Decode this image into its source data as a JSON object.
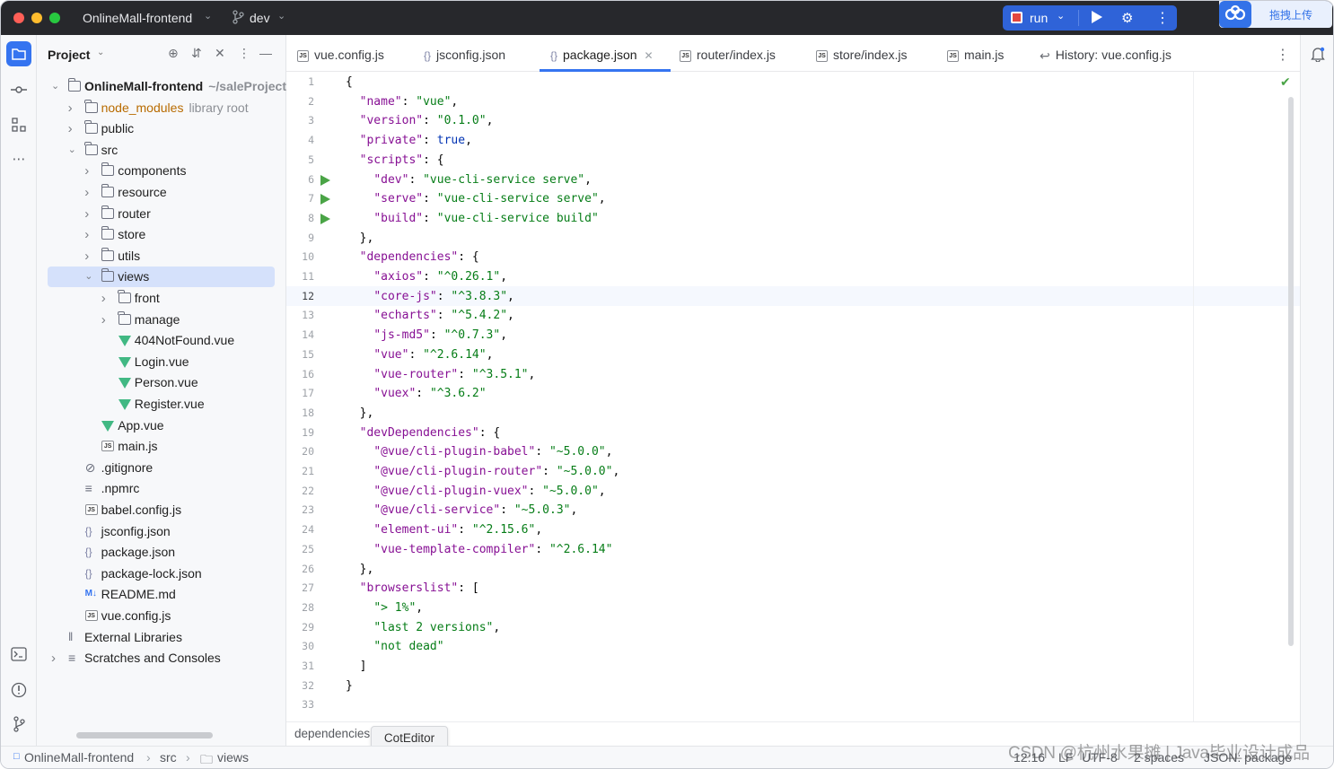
{
  "titlebar": {
    "project": "OnlineMall-frontend",
    "branch": "dev",
    "run_label": "run",
    "baidu_label": "拖拽上传"
  },
  "project_panel": {
    "title": "Project",
    "tree": [
      {
        "label": "OnlineMall-frontend",
        "suffix": "~/saleProject",
        "type": "folder",
        "depth": 0,
        "expanded": true,
        "bold": true
      },
      {
        "label": "node_modules",
        "suffix": "library root",
        "type": "folder",
        "depth": 1,
        "expanded": false,
        "excluded": true
      },
      {
        "label": "public",
        "type": "folder",
        "depth": 1,
        "expanded": false
      },
      {
        "label": "src",
        "type": "folder",
        "depth": 1,
        "expanded": true
      },
      {
        "label": "components",
        "type": "folder",
        "depth": 2,
        "expanded": false
      },
      {
        "label": "resource",
        "type": "folder",
        "depth": 2,
        "expanded": false
      },
      {
        "label": "router",
        "type": "folder",
        "depth": 2,
        "expanded": false
      },
      {
        "label": "store",
        "type": "folder",
        "depth": 2,
        "expanded": false
      },
      {
        "label": "utils",
        "type": "folder",
        "depth": 2,
        "expanded": false
      },
      {
        "label": "views",
        "type": "folder",
        "depth": 2,
        "expanded": true,
        "selected": true
      },
      {
        "label": "front",
        "type": "folder",
        "depth": 3,
        "expanded": false
      },
      {
        "label": "manage",
        "type": "folder",
        "depth": 3,
        "expanded": false
      },
      {
        "label": "404NotFound.vue",
        "type": "vue",
        "depth": 3
      },
      {
        "label": "Login.vue",
        "type": "vue",
        "depth": 3
      },
      {
        "label": "Person.vue",
        "type": "vue",
        "depth": 3
      },
      {
        "label": "Register.vue",
        "type": "vue",
        "depth": 3
      },
      {
        "label": "App.vue",
        "type": "vue",
        "depth": 2
      },
      {
        "label": "main.js",
        "type": "js",
        "depth": 2
      },
      {
        "label": ".gitignore",
        "type": "ignore",
        "depth": 1
      },
      {
        "label": ".npmrc",
        "type": "text",
        "depth": 1
      },
      {
        "label": "babel.config.js",
        "type": "js",
        "depth": 1
      },
      {
        "label": "jsconfig.json",
        "type": "json",
        "depth": 1
      },
      {
        "label": "package.json",
        "type": "json",
        "depth": 1
      },
      {
        "label": "package-lock.json",
        "type": "json",
        "depth": 1
      },
      {
        "label": "README.md",
        "type": "md",
        "depth": 1
      },
      {
        "label": "vue.config.js",
        "type": "js",
        "depth": 1
      },
      {
        "label": "External Libraries",
        "type": "lib",
        "depth": 0
      },
      {
        "label": "Scratches and Consoles",
        "type": "scratch",
        "depth": 0,
        "expanded": false
      }
    ]
  },
  "tabs": [
    {
      "label": "vue.config.js",
      "icon": "js-icon"
    },
    {
      "label": "jsconfig.json",
      "icon": "json-icon"
    },
    {
      "label": "package.json",
      "icon": "json-icon",
      "active": true
    },
    {
      "label": "router/index.js",
      "icon": "js-icon"
    },
    {
      "label": "store/index.js",
      "icon": "js-icon"
    },
    {
      "label": "main.js",
      "icon": "js-icon"
    },
    {
      "label": "History: vue.config.js",
      "icon": "history-icon"
    }
  ],
  "editor": {
    "current_line": 12,
    "run_lines": [
      6,
      7,
      8
    ],
    "lines": [
      "{",
      "  \"name\": \"vue\",",
      "  \"version\": \"0.1.0\",",
      "  \"private\": true,",
      "  \"scripts\": {",
      "    \"dev\": \"vue-cli-service serve\",",
      "    \"serve\": \"vue-cli-service serve\",",
      "    \"build\": \"vue-cli-service build\"",
      "  },",
      "  \"dependencies\": {",
      "    \"axios\": \"^0.26.1\",",
      "    \"core-js\": \"^3.8.3\",",
      "    \"echarts\": \"^5.4.2\",",
      "    \"js-md5\": \"^0.7.3\",",
      "    \"vue\": \"^2.6.14\",",
      "    \"vue-router\": \"^3.5.1\",",
      "    \"vuex\": \"^3.6.2\"",
      "  },",
      "  \"devDependencies\": {",
      "    \"@vue/cli-plugin-babel\": \"~5.0.0\",",
      "    \"@vue/cli-plugin-router\": \"~5.0.0\",",
      "    \"@vue/cli-plugin-vuex\": \"~5.0.0\",",
      "    \"@vue/cli-service\": \"~5.0.3\",",
      "    \"element-ui\": \"^2.15.6\",",
      "    \"vue-template-compiler\": \"^2.6.14\"",
      "  },",
      "  \"browserslist\": [",
      "    \"> 1%\",",
      "    \"last 2 versions\",",
      "    \"not dead\"",
      "  ]",
      "}",
      ""
    ]
  },
  "editor_breadcrumb": {
    "label": "dependencies",
    "hidden_label": "core-js"
  },
  "tooltip": {
    "label": "CotEditor"
  },
  "statusbar": {
    "crumbs": [
      "OnlineMall-frontend",
      "src",
      "views"
    ],
    "position": "12:16",
    "line_sep": "LF",
    "encoding": "UTF-8",
    "indent": "2 spaces",
    "schema": "JSON: package"
  },
  "watermark": "CSDN @杭州水果摊 | Java毕业设计成品",
  "colors": {
    "accent": "#3574f0",
    "titlebar": "#27282c",
    "run_button": "#2f63d8",
    "string": "#067d17",
    "key": "#871094",
    "keyword": "#0033b3"
  }
}
